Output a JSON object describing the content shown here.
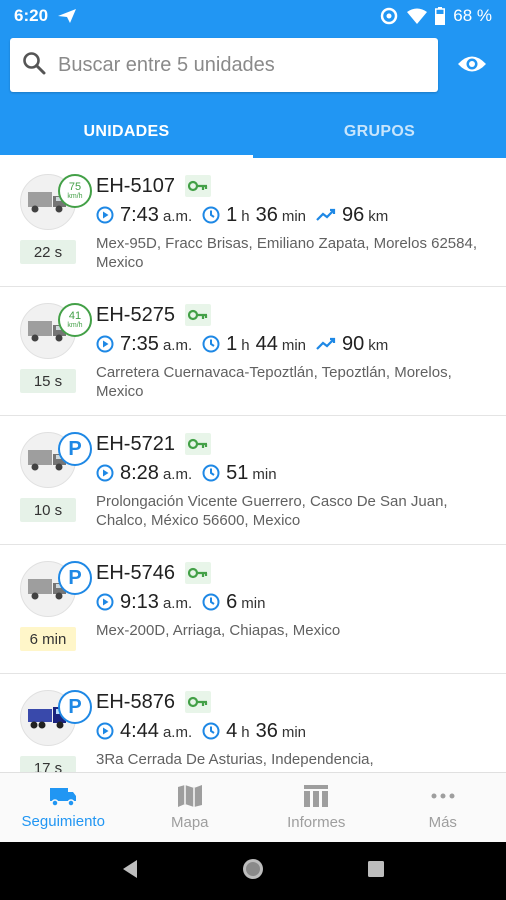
{
  "status_bar": {
    "time": "6:20",
    "battery": "68 %"
  },
  "search": {
    "placeholder": "Buscar entre 5 unidades"
  },
  "tabs": [
    {
      "label": "UNIDADES"
    },
    {
      "label": "GRUPOS"
    }
  ],
  "units": [
    {
      "name": "EH-5107",
      "speed": "75",
      "speed_unit": "km/h",
      "age": "22 s",
      "time": "7:43",
      "ampm": "a.m.",
      "dur_h": "1",
      "dur_h_unit": "h",
      "dur_m": "36",
      "dur_m_unit": "min",
      "dist": "96",
      "dist_unit": "km",
      "address": "Mex-95D, Fracc Brisas, Emiliano Zapata, Morelos 62584, Mexico"
    },
    {
      "name": "EH-5275",
      "speed": "41",
      "speed_unit": "km/h",
      "age": "15 s",
      "time": "7:35",
      "ampm": "a.m.",
      "dur_h": "1",
      "dur_h_unit": "h",
      "dur_m": "44",
      "dur_m_unit": "min",
      "dist": "90",
      "dist_unit": "km",
      "address": "Carretera Cuernavaca-Tepoztlán, Tepoztlán, Morelos, Mexico"
    },
    {
      "name": "EH-5721",
      "parked": "P",
      "age": "10 s",
      "time": "8:28",
      "ampm": "a.m.",
      "dur_m": "51",
      "dur_m_unit": "min",
      "address": "Prolongación Vicente Guerrero, Casco De San Juan, Chalco, México 56600, Mexico"
    },
    {
      "name": "EH-5746",
      "parked": "P",
      "age": "6 min",
      "time": "9:13",
      "ampm": "a.m.",
      "dur_m": "6",
      "dur_m_unit": "min",
      "address": "Mex-200D, Arriaga, Chiapas, Mexico"
    },
    {
      "name": "EH-5876",
      "parked": "P",
      "age": "17 s",
      "time": "4:44",
      "ampm": "a.m.",
      "dur_h": "4",
      "dur_h_unit": "h",
      "dur_m": "36",
      "dur_m_unit": "min",
      "address": "3Ra Cerrada De Asturias, Independencia,"
    }
  ],
  "bottom_nav": [
    {
      "label": "Seguimiento",
      "icon": "truck-icon"
    },
    {
      "label": "Mapa",
      "icon": "map-icon"
    },
    {
      "label": "Informes",
      "icon": "reports-icon"
    },
    {
      "label": "Más",
      "icon": "more-icon"
    }
  ],
  "colors": {
    "primary": "#2196f3",
    "green": "#43a047",
    "blue_icon": "#1e88e5"
  }
}
